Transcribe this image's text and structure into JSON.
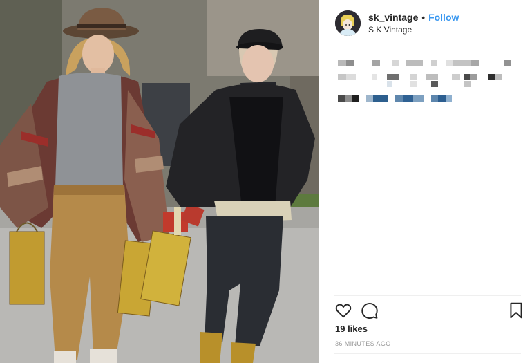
{
  "post": {
    "username": "sk_vintage",
    "separator": "•",
    "follow_label": "Follow",
    "location": "S K Vintage",
    "likes_text": "19 likes",
    "time_ago": "36 MINUTES AGO",
    "caption_state": "pixelated"
  },
  "icons": {
    "like": "heart-icon",
    "comment": "comment-icon",
    "save": "bookmark-icon"
  },
  "colors": {
    "follow_accent": "#3897f0",
    "text": "#262626",
    "muted": "#999999",
    "divider": "#efefef"
  }
}
